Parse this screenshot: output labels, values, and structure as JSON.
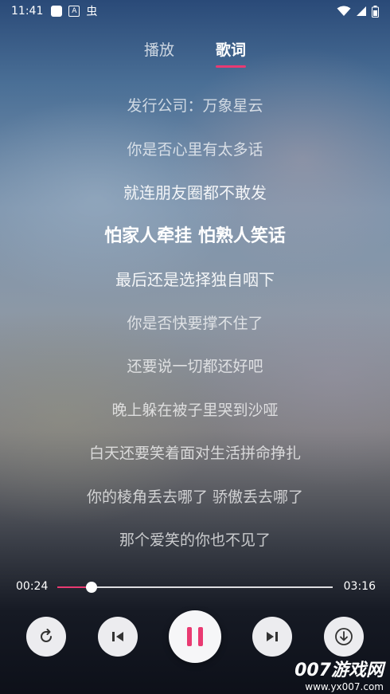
{
  "status_bar": {
    "time": "11:41",
    "notification_icons": [
      "square-icon",
      "a-badge-icon"
    ],
    "extra_char": "虫",
    "right_icons": [
      "wifi-icon",
      "signal-icon",
      "battery-icon"
    ]
  },
  "tabs": [
    {
      "label": "播放",
      "active": false
    },
    {
      "label": "歌词",
      "active": true
    }
  ],
  "accent_color": "#e93a72",
  "lyrics": [
    {
      "text": "发行公司：万象星云"
    },
    {
      "text": "你是否心里有太多话"
    },
    {
      "text": "就连朋友圈都不敢发"
    },
    {
      "text": "怕家人牵挂 怕熟人笑话"
    },
    {
      "text": "最后还是选择独自咽下"
    },
    {
      "text": "你是否快要撑不住了"
    },
    {
      "text": "还要说一切都还好吧"
    },
    {
      "text": "晚上躲在被子里哭到沙哑"
    },
    {
      "text": "白天还要笑着面对生活拼命挣扎"
    },
    {
      "text": "你的棱角丢去哪了 骄傲丢去哪了"
    },
    {
      "text": "那个爱笑的你也不见了"
    }
  ],
  "current_lyric_index": 3,
  "player": {
    "current_time": "00:24",
    "total_time": "03:16",
    "progress": 0.125,
    "state": "playing"
  },
  "controls": [
    "repeat-icon",
    "previous-icon",
    "pause-icon",
    "next-icon",
    "download-icon"
  ],
  "watermark": {
    "line1": "007游戏网",
    "line2": "www.yx007.com"
  }
}
